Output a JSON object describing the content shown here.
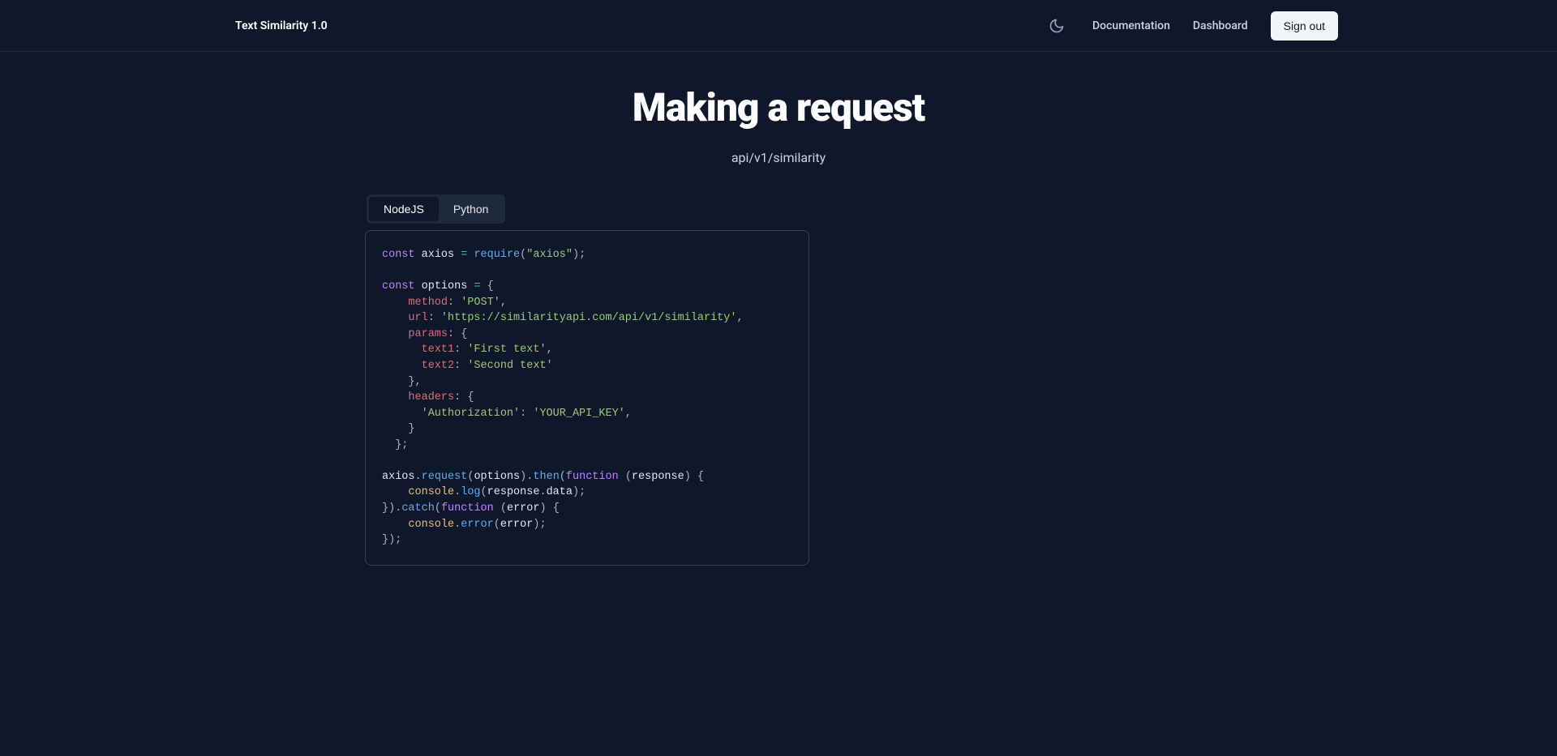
{
  "header": {
    "brand": "Text Similarity 1.0",
    "nav": {
      "documentation": "Documentation",
      "dashboard": "Dashboard",
      "signout": "Sign out"
    }
  },
  "page": {
    "title": "Making a request",
    "endpoint": "api/v1/similarity"
  },
  "tabs": {
    "nodejs": "NodeJS",
    "python": "Python"
  },
  "code": {
    "line1_const": "const",
    "line1_axios": " axios ",
    "line1_eq": "=",
    "line1_require": " require",
    "line1_paren1": "(",
    "line1_str": "\"axios\"",
    "line1_paren2": ")",
    "line1_semi": ";",
    "line3_const": "const",
    "line3_options": " options ",
    "line3_eq": "=",
    "line3_brace": " {",
    "line4_method": "    method",
    "line4_colon": ":",
    "line4_str": " 'POST'",
    "line4_comma": ",",
    "line5_url": "    url",
    "line5_colon": ":",
    "line5_str": " 'https://similarityapi.com/api/v1/similarity'",
    "line5_comma": ",",
    "line6_params": "    params",
    "line6_colon": ":",
    "line6_brace": " {",
    "line7_text1": "      text1",
    "line7_colon": ":",
    "line7_str": " 'First text'",
    "line7_comma": ",",
    "line8_text2": "      text2",
    "line8_colon": ":",
    "line8_str": " 'Second text'",
    "line9_close": "    },",
    "line10_headers": "    headers",
    "line10_colon": ":",
    "line10_brace": " {",
    "line11_key": "      'Authorization'",
    "line11_colon": ":",
    "line11_str": " 'YOUR_API_KEY'",
    "line11_comma": ",",
    "line12_close": "    }",
    "line13_close": "  };",
    "line15_axios": "axios",
    "line15_dot1": ".",
    "line15_request": "request",
    "line15_p1": "(",
    "line15_options": "options",
    "line15_p2": ")",
    "line15_dot2": ".",
    "line15_then": "then",
    "line15_p3": "(",
    "line15_function": "function",
    "line15_p4": " (",
    "line15_response": "response",
    "line15_p5": ")",
    "line15_brace": " {",
    "line16_console": "    console",
    "line16_dot": ".",
    "line16_log": "log",
    "line16_p1": "(",
    "line16_response": "response",
    "line16_dot2": ".",
    "line16_data": "data",
    "line16_p2": ")",
    "line16_semi": ";",
    "line17_close": "}",
    "line17_p1": ")",
    "line17_dot": ".",
    "line17_catch": "catch",
    "line17_p2": "(",
    "line17_function": "function",
    "line17_p3": " (",
    "line17_error": "error",
    "line17_p4": ")",
    "line17_brace": " {",
    "line18_console": "    console",
    "line18_dot": ".",
    "line18_errorfn": "error",
    "line18_p1": "(",
    "line18_error": "error",
    "line18_p2": ")",
    "line18_semi": ";",
    "line19_close": "}",
    "line19_p": ")",
    "line19_semi": ";"
  }
}
